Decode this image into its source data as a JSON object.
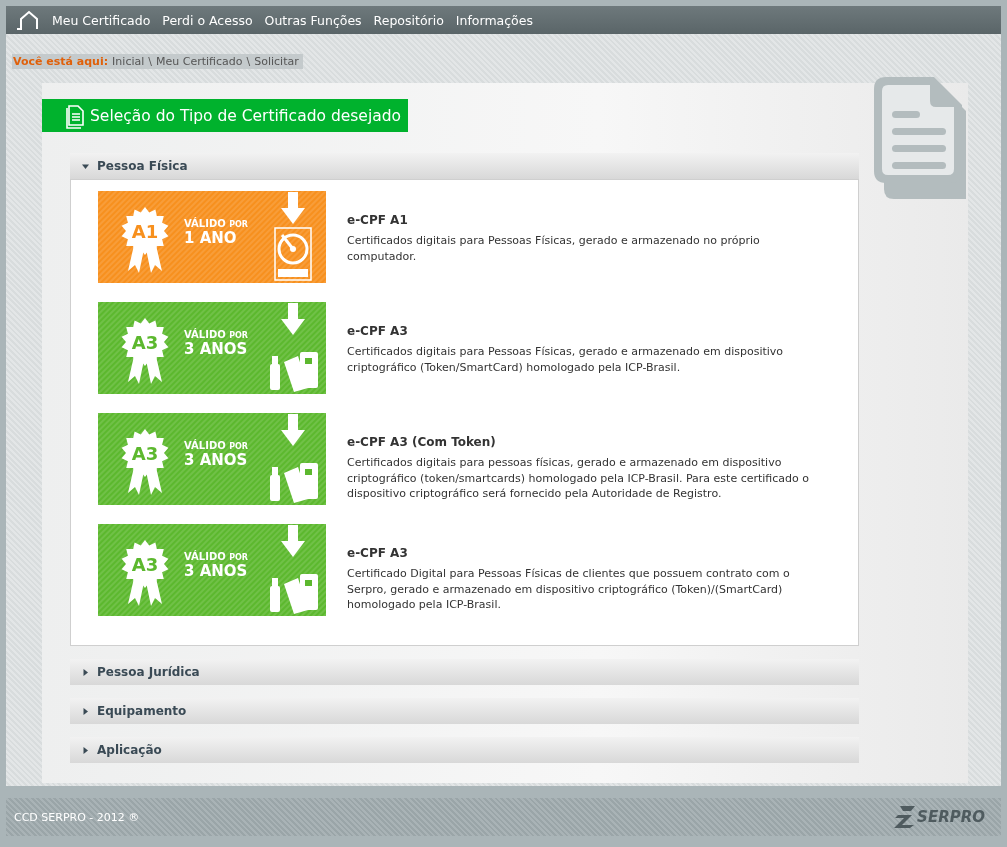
{
  "nav": {
    "items": [
      "Meu Certificado",
      "Perdi o Acesso",
      "Outras Funções",
      "Repositório",
      "Informações"
    ]
  },
  "breadcrumb": {
    "label": "Você está aqui:",
    "separator": "\\",
    "items": [
      "Inicial",
      "Meu Certificado",
      "Solicitar"
    ]
  },
  "page_title": "Seleção do Tipo de Certificado desejado",
  "sections": [
    {
      "title": "Pessoa Física",
      "expanded": true,
      "certificates": [
        {
          "name": "e-CPF A1",
          "description": "Certificados digitais para Pessoas Físicas, gerado e armazenado no próprio computador.",
          "banner": {
            "badge": "A1",
            "valid": "VÁLIDO",
            "por": "POR",
            "duration": "1 ANO",
            "color": "#f7901e",
            "kind": "disk"
          }
        },
        {
          "name": "e-CPF A3",
          "description": "Certificados digitais para Pessoas Físicas, gerado e armazenado em dispositivo criptográfico (Token/SmartCard) homologado pela ICP-Brasil.",
          "banner": {
            "badge": "A3",
            "valid": "VÁLIDO",
            "por": "POR",
            "duration": "3 ANOS",
            "color": "#5cb82e",
            "kind": "token"
          }
        },
        {
          "name": "e-CPF A3 (Com Token)",
          "description": "Certificados digitais para pessoas físicas, gerado e armazenado em dispositivo criptográfico (token/smartcards) homologado pela ICP-Brasil. Para este certificado o dispositivo criptográfico será fornecido pela Autoridade de Registro.",
          "banner": {
            "badge": "A3",
            "valid": "VÁLIDO",
            "por": "POR",
            "duration": "3 ANOS",
            "color": "#5cb82e",
            "kind": "token"
          }
        },
        {
          "name": "e-CPF A3",
          "description": "Certificado Digital para Pessoas Físicas de clientes que possuem contrato com o Serpro, gerado e armazenado em dispositivo criptográfico (Token)/(SmartCard) homologado pela ICP-Brasil.",
          "banner": {
            "badge": "A3",
            "valid": "VÁLIDO",
            "por": "POR",
            "duration": "3 ANOS",
            "color": "#5cb82e",
            "kind": "token"
          }
        }
      ]
    },
    {
      "title": "Pessoa Jurídica",
      "expanded": false
    },
    {
      "title": "Equipamento",
      "expanded": false
    },
    {
      "title": "Aplicação",
      "expanded": false
    }
  ],
  "footer": {
    "copyright": "CCD SERPRO - 2012 ®",
    "logo": "SERPRO"
  }
}
